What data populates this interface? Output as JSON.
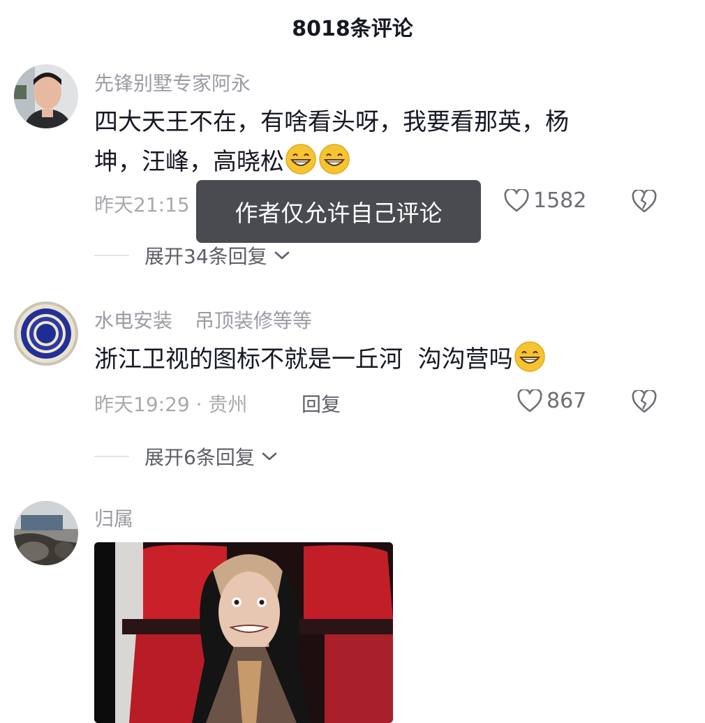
{
  "header": {
    "title": "8018条评论"
  },
  "toast": {
    "text": "作者仅允许自己评论"
  },
  "comments": [
    {
      "username": "先锋别墅专家阿永",
      "text_line1": "四大天王不在，有啥看头呀，我要看那英，杨",
      "text_line2": "坤，汪峰，高晓松",
      "time": "昨天21:15",
      "likes": "1582",
      "expand": "展开34条回复"
    },
    {
      "username": "水电安装",
      "username_extra": "吊顶装修等等",
      "text": "浙江卫视的图标不就是一丘河  沟沟营吗",
      "meta": "昨天19:29 · 贵州",
      "reply": "回复",
      "likes": "867",
      "expand": "展开6条回复"
    },
    {
      "username": "归属"
    }
  ],
  "icons": {
    "like": "heart-outline-icon",
    "dislike": "broken-heart-icon",
    "expand": "chevron-down-icon",
    "emoji": "grin-emoji-icon"
  },
  "colors": {
    "primary_text": "#161823",
    "secondary_text": "#9a9ca3",
    "toast_bg": "#4a4b50",
    "emoji_yellow": "#f7c431"
  }
}
